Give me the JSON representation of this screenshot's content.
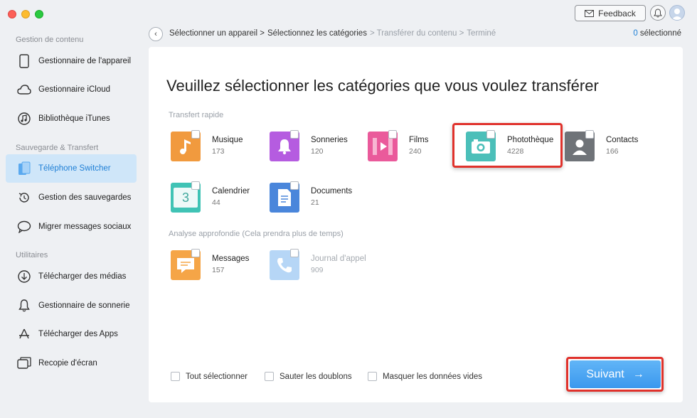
{
  "header": {
    "feedback_label": "Feedback"
  },
  "sidebar": {
    "sections": [
      {
        "title": "Gestion de contenu"
      },
      {
        "title": "Sauvegarde & Transfert"
      },
      {
        "title": "Utilitaires"
      }
    ],
    "items": [
      {
        "label": "Gestionnaire de l'appareil",
        "icon": "phone-icon"
      },
      {
        "label": "Gestionnaire iCloud",
        "icon": "cloud-icon"
      },
      {
        "label": "Bibliothèque iTunes",
        "icon": "music-note-icon"
      },
      {
        "label": "Téléphone Switcher",
        "icon": "phone-switch-icon",
        "active": true
      },
      {
        "label": "Gestion des sauvegardes",
        "icon": "backup-clock-icon"
      },
      {
        "label": "Migrer messages sociaux",
        "icon": "chat-bubble-icon"
      },
      {
        "label": "Télécharger des médias",
        "icon": "download-circle-icon"
      },
      {
        "label": "Gestionnaire de sonnerie",
        "icon": "bell-icon"
      },
      {
        "label": "Télécharger des Apps",
        "icon": "app-store-icon"
      },
      {
        "label": "Recopie d'écran",
        "icon": "screen-mirror-icon"
      }
    ]
  },
  "breadcrumb": {
    "steps": [
      {
        "label": "Sélectionner un appareil >",
        "done": true
      },
      {
        "label": "Sélectionnez les catégories",
        "done": true
      },
      {
        "label": "> Transférer du contenu >",
        "done": false
      },
      {
        "label": "Terminé",
        "done": false
      }
    ],
    "selected_count": "0",
    "selected_label": "sélectionné"
  },
  "main": {
    "heading": "Veuillez sélectionner les catégories que vous voulez transférer",
    "quick_label": "Transfert rapide",
    "deep_label": "Analyse approfondie (Cela prendra plus de temps)",
    "quick_categories": [
      {
        "name": "Musique",
        "count": "173",
        "icon": "music-icon",
        "color": "#f19a3e"
      },
      {
        "name": "Sonneries",
        "count": "120",
        "icon": "bell-icon",
        "color": "#b55ce0"
      },
      {
        "name": "Films",
        "count": "240",
        "icon": "film-icon",
        "color": "#ea5a9b"
      },
      {
        "name": "Photothèque",
        "count": "4228",
        "icon": "camera-icon",
        "color": "#4bbfb9"
      },
      {
        "name": "Contacts",
        "count": "166",
        "icon": "contact-icon",
        "color": "#6f7378"
      },
      {
        "name": "Calendrier",
        "count": "44",
        "icon": "calendar-icon",
        "color": "#40c3b5",
        "tile_text": "3"
      },
      {
        "name": "Documents",
        "count": "21",
        "icon": "document-icon",
        "color": "#4a86db"
      }
    ],
    "deep_categories": [
      {
        "name": "Messages",
        "count": "157",
        "icon": "message-icon",
        "color": "#f5a547"
      },
      {
        "name": "Journal d'appel",
        "count": "909",
        "icon": "phone-call-icon",
        "color": "#5ea6ec",
        "dim": true
      }
    ],
    "options": [
      {
        "label": "Tout sélectionner"
      },
      {
        "label": "Sauter les doublons"
      },
      {
        "label": "Masquer les données vides"
      }
    ],
    "next_label": "Suivant",
    "next_arrow": "→"
  },
  "colors": {
    "accent": "#1e7fd6",
    "highlight": "#e0322c",
    "button": "#3b98ee"
  }
}
